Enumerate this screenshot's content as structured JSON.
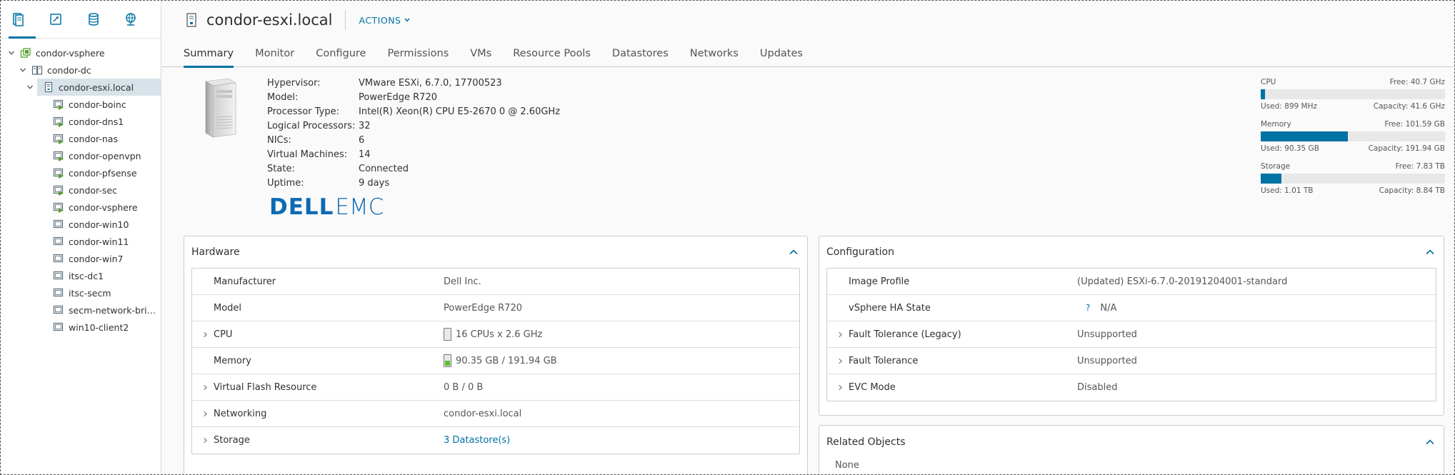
{
  "nav": {
    "tabs": [
      {
        "name": "hosts-and-clusters-tab-icon"
      },
      {
        "name": "vms-and-templates-tab-icon"
      },
      {
        "name": "storage-tab-icon"
      },
      {
        "name": "networking-tab-icon"
      }
    ],
    "tree": [
      {
        "label": "condor-vsphere",
        "level": 0,
        "icon": "vcenter-icon",
        "expanded": true
      },
      {
        "label": "condor-dc",
        "level": 1,
        "icon": "datacenter-icon",
        "expanded": true
      },
      {
        "label": "condor-esxi.local",
        "level": 2,
        "icon": "host-icon",
        "expanded": true,
        "selected": true
      },
      {
        "label": "condor-boinc",
        "level": 3,
        "icon": "vm-on-icon"
      },
      {
        "label": "condor-dns1",
        "level": 3,
        "icon": "vm-on-icon"
      },
      {
        "label": "condor-nas",
        "level": 3,
        "icon": "vm-on-icon"
      },
      {
        "label": "condor-openvpn",
        "level": 3,
        "icon": "vm-on-icon"
      },
      {
        "label": "condor-pfsense",
        "level": 3,
        "icon": "vm-on-icon"
      },
      {
        "label": "condor-sec",
        "level": 3,
        "icon": "vm-on-icon"
      },
      {
        "label": "condor-vsphere",
        "level": 3,
        "icon": "vm-on-icon"
      },
      {
        "label": "condor-win10",
        "level": 3,
        "icon": "vm-off-icon"
      },
      {
        "label": "condor-win11",
        "level": 3,
        "icon": "vm-off-icon"
      },
      {
        "label": "condor-win7",
        "level": 3,
        "icon": "vm-off-icon"
      },
      {
        "label": "itsc-dc1",
        "level": 3,
        "icon": "vm-off-icon"
      },
      {
        "label": "itsc-secm",
        "level": 3,
        "icon": "vm-off-icon"
      },
      {
        "label": "secm-network-brid...",
        "level": 3,
        "icon": "vm-off-icon"
      },
      {
        "label": "win10-client2",
        "level": 3,
        "icon": "vm-off-icon"
      }
    ]
  },
  "header": {
    "title": "condor-esxi.local",
    "actions_label": "ACTIONS"
  },
  "tabs": [
    "Summary",
    "Monitor",
    "Configure",
    "Permissions",
    "VMs",
    "Resource Pools",
    "Datastores",
    "Networks",
    "Updates"
  ],
  "active_tab": "Summary",
  "summary": {
    "props": [
      {
        "key": "Hypervisor:",
        "value": "VMware ESXi, 6.7.0, 17700523"
      },
      {
        "key": "Model:",
        "value": "PowerEdge R720"
      },
      {
        "key": "Processor Type:",
        "value": "Intel(R) Xeon(R) CPU E5-2670 0 @ 2.60GHz"
      },
      {
        "key": "Logical Processors:",
        "value": "32"
      },
      {
        "key": "NICs:",
        "value": "6"
      },
      {
        "key": "Virtual Machines:",
        "value": "14"
      },
      {
        "key": "State:",
        "value": "Connected"
      },
      {
        "key": "Uptime:",
        "value": "9 days"
      }
    ],
    "vendor_logo": {
      "part1": "DELL",
      "part2": "EMC"
    }
  },
  "resources": [
    {
      "name": "CPU",
      "free": "Free: 40.7 GHz",
      "used": "Used: 899 MHz",
      "capacity": "Capacity: 41.6 GHz",
      "fraction": 0.022
    },
    {
      "name": "Memory",
      "free": "Free: 101.59 GB",
      "used": "Used: 90.35 GB",
      "capacity": "Capacity: 191.94 GB",
      "fraction": 0.471
    },
    {
      "name": "Storage",
      "free": "Free: 7.83 TB",
      "used": "Used: 1.01 TB",
      "capacity": "Capacity: 8.84 TB",
      "fraction": 0.114
    }
  ],
  "hardware": {
    "title": "Hardware",
    "rows": [
      {
        "key": "Manufacturer",
        "value": "Dell Inc.",
        "expandable": false
      },
      {
        "key": "Model",
        "value": "PowerEdge R720",
        "expandable": false
      },
      {
        "key": "CPU",
        "value": "16 CPUs x 2.6 GHz",
        "expandable": true,
        "icon": "cpu-icon"
      },
      {
        "key": "Memory",
        "value": "90.35 GB / 191.94 GB",
        "expandable": false,
        "icon": "memory-icon"
      },
      {
        "key": "Virtual Flash Resource",
        "value": "0 B / 0 B",
        "expandable": true
      },
      {
        "key": "Networking",
        "value": "condor-esxi.local",
        "expandable": true
      },
      {
        "key": "Storage",
        "value": "3 Datastore(s)",
        "expandable": true,
        "link": true
      }
    ]
  },
  "configuration": {
    "title": "Configuration",
    "rows": [
      {
        "key": "Image Profile",
        "value": "(Updated) ESXi-6.7.0-20191204001-standard",
        "expandable": false
      },
      {
        "key": "vSphere HA State",
        "value": "N/A",
        "expandable": false,
        "help": "?"
      },
      {
        "key": "Fault Tolerance (Legacy)",
        "value": "Unsupported",
        "expandable": true
      },
      {
        "key": "Fault Tolerance",
        "value": "Unsupported",
        "expandable": true
      },
      {
        "key": "EVC Mode",
        "value": "Disabled",
        "expandable": true
      }
    ]
  },
  "related": {
    "title": "Related Objects",
    "value": "None"
  },
  "colors": {
    "accent": "#0072a3",
    "vendor": "#0c6ab3",
    "memory_green": "#5fbf2f"
  }
}
